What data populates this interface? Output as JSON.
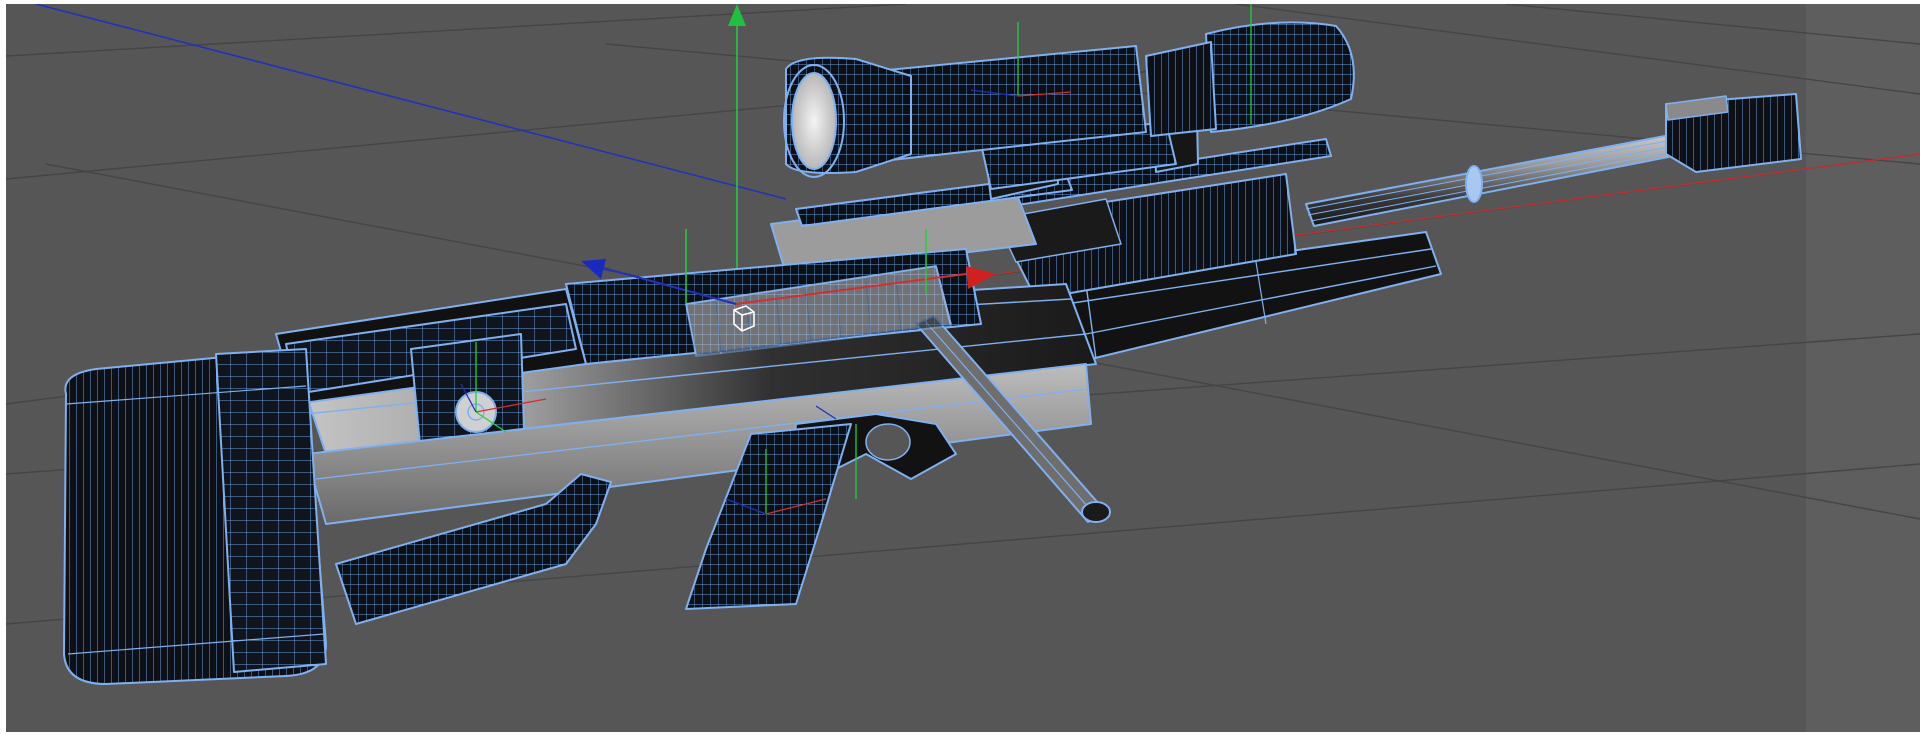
{
  "app": {
    "name": ""
  },
  "viewport": {
    "background_color": "#565656",
    "right_margin_color": "#5e5e5e",
    "grid_color": "#3e3e3e",
    "wire_color": "#7fb0f0",
    "mesh_fill_color": "#0e1218",
    "axis_colors": {
      "x": "#d03030",
      "y": "#20d040",
      "z": "#2030c0"
    },
    "model_name": "",
    "selected": true
  },
  "icons": {
    "world_axis_x": "axis-x-line-icon",
    "world_axis_y": "axis-y-arrow-icon",
    "world_axis_z": "axis-z-line-icon",
    "transform_gizmo": "move-gizmo-icon",
    "object_pivot": "pivot-cube-icon"
  }
}
